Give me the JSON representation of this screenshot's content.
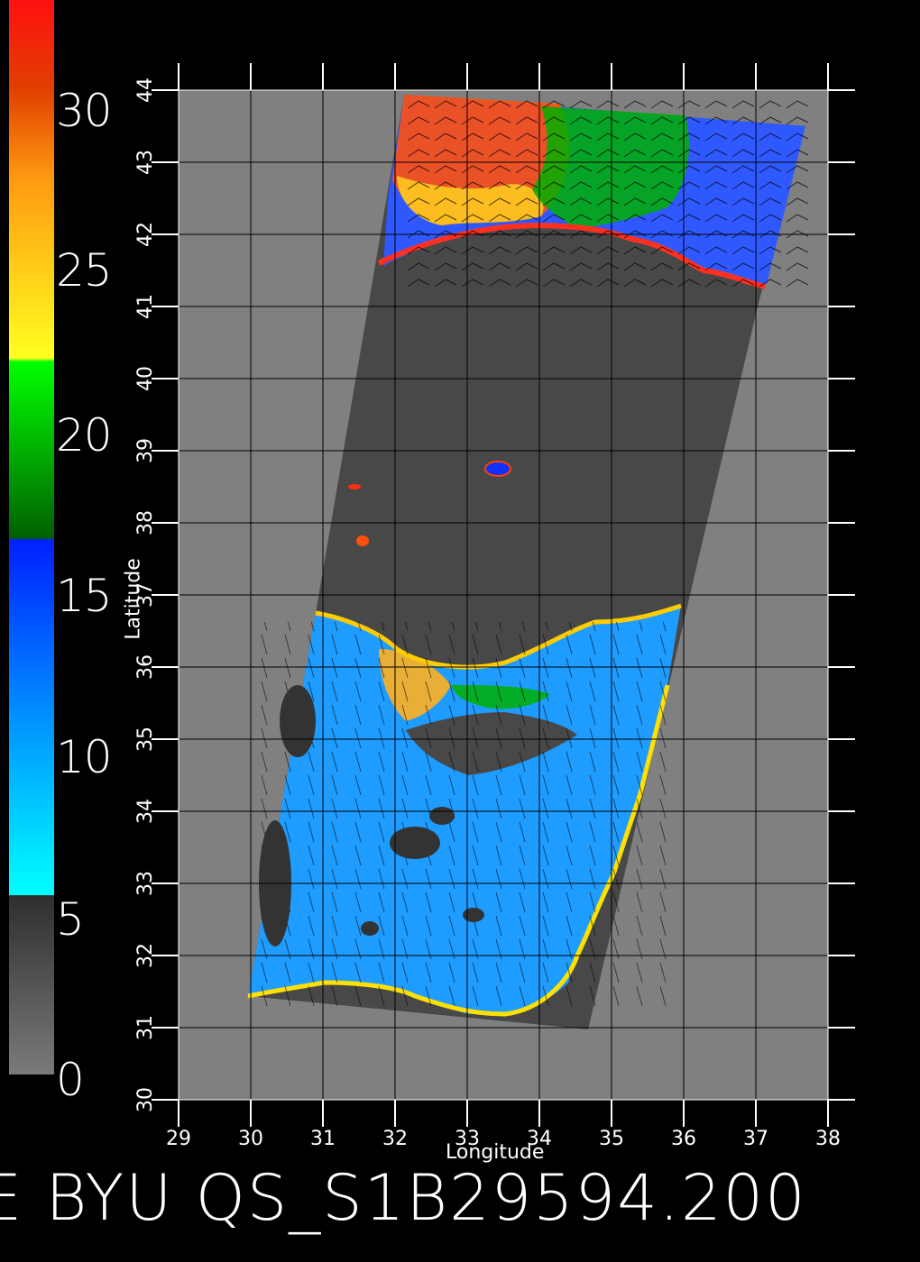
{
  "colorbar": {
    "labels": [
      "30",
      "25",
      "20",
      "15",
      "10",
      "5",
      "0"
    ],
    "stops": [
      {
        "value": 0,
        "color": "#7a7a7a"
      },
      {
        "value": 5,
        "color": "#2e2e2e"
      },
      {
        "value": 5.01,
        "color": "#00ffff"
      },
      {
        "value": 10,
        "color": "#0090ff"
      },
      {
        "value": 14.9,
        "color": "#0020ff"
      },
      {
        "value": 15,
        "color": "#006000"
      },
      {
        "value": 19.9,
        "color": "#00ff00"
      },
      {
        "value": 20,
        "color": "#ffff20"
      },
      {
        "value": 25,
        "color": "#ff9a10"
      },
      {
        "value": 27.5,
        "color": "#e04000"
      },
      {
        "value": 30,
        "color": "#ff1010"
      }
    ]
  },
  "map": {
    "lon_ticks": [
      "29",
      "30",
      "31",
      "32",
      "33",
      "34",
      "35",
      "36",
      "37",
      "38"
    ],
    "lat_ticks": [
      "30",
      "31",
      "32",
      "33",
      "34",
      "35",
      "36",
      "37",
      "38",
      "39",
      "40",
      "41",
      "42",
      "43",
      "44"
    ],
    "lon_range": [
      29,
      38
    ],
    "lat_range": [
      30,
      44
    ],
    "xlabel": "Longitude",
    "ylabel": "Latitude",
    "background_color": "#808080",
    "land_color": "#484848",
    "grid_color": "#000000"
  },
  "footer": {
    "text": "E   BYU QS_S1B29594.200"
  }
}
